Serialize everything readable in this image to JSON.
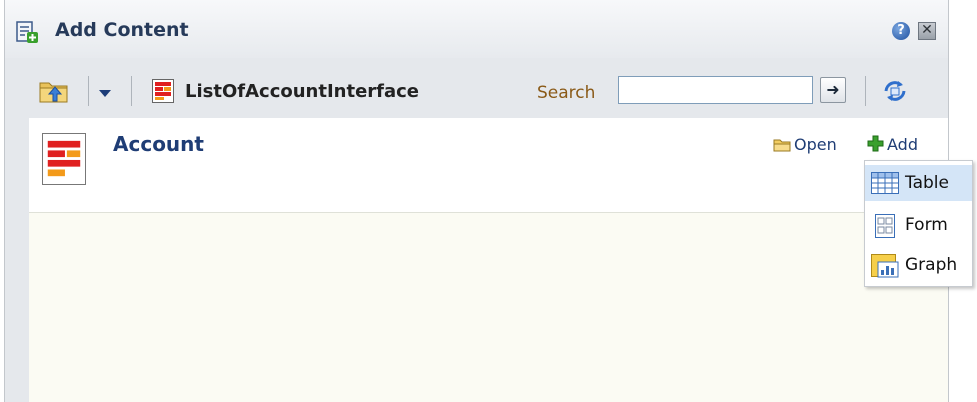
{
  "dialog": {
    "title": "Add Content",
    "help_label": "?",
    "close_label": "✕"
  },
  "toolbar": {
    "current_path": "ListOfAccountInterface",
    "search_label": "Search",
    "search_value": "",
    "go_label": "➜"
  },
  "item": {
    "title": "Account",
    "open_label": "Open",
    "add_label": "Add"
  },
  "add_menu": {
    "items": [
      {
        "label": "Table",
        "icon": "table-icon",
        "highlighted": true
      },
      {
        "label": "Form",
        "icon": "form-icon",
        "highlighted": false
      },
      {
        "label": "Graph",
        "icon": "graph-icon",
        "highlighted": false
      }
    ]
  },
  "colors": {
    "link": "#1f3d75",
    "search_label": "#8a5a18",
    "menu_highlight": "#d4e5f7",
    "content_bg": "#fbfbf3"
  }
}
